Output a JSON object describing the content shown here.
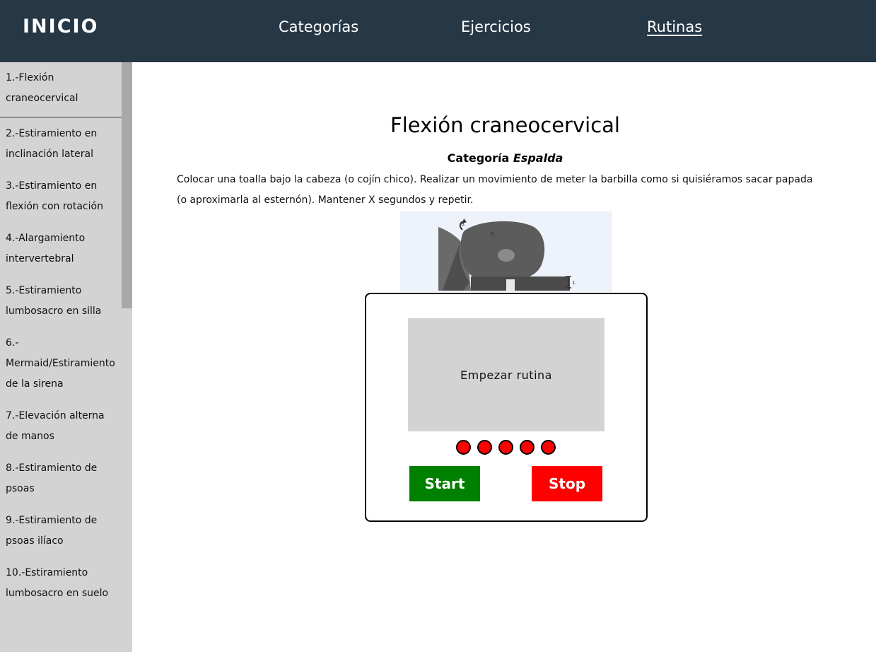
{
  "header": {
    "brand": "INICIO",
    "nav": [
      {
        "label": "Categorías"
      },
      {
        "label": "Ejercicios"
      },
      {
        "label": "Rutinas"
      }
    ]
  },
  "sidebar": {
    "items": [
      {
        "label": "1.-Flexión craneocervical"
      },
      {
        "label": "2.-Estiramiento en inclinación lateral"
      },
      {
        "label": "3.-Estiramiento en flexión con rotación"
      },
      {
        "label": "4.-Alargamiento intervertebral"
      },
      {
        "label": "5.-Estiramiento lumbosacro en silla"
      },
      {
        "label": "6.-Mermaid/Estiramiento de la sirena"
      },
      {
        "label": "7.-Elevación alterna de manos"
      },
      {
        "label": "8.-Estiramiento de psoas"
      },
      {
        "label": "9.-Estiramiento de psoas ilíaco"
      },
      {
        "label": "10.-Estiramiento lumbosacro en suelo"
      }
    ]
  },
  "exercise": {
    "title": "Flexión craneocervical",
    "category_prefix": "Categoría",
    "category_value": "Espalda",
    "description": "Colocar una toalla bajo la cabeza (o cojín chico). Realizar un movimiento de meter la barbilla como si quisiéramos sacar papada (o aproximarla al esternón). Mantener X segundos y repetir."
  },
  "routine": {
    "screen_text": "Empezar rutina",
    "step_dots": 5,
    "dot_color": "#ff0000",
    "start_label": "Start",
    "stop_label": "Stop",
    "start_color": "#008000",
    "stop_color": "#ff0000"
  },
  "colors": {
    "header_bg": "#263745",
    "sidebar_bg": "#d3d3d3"
  }
}
